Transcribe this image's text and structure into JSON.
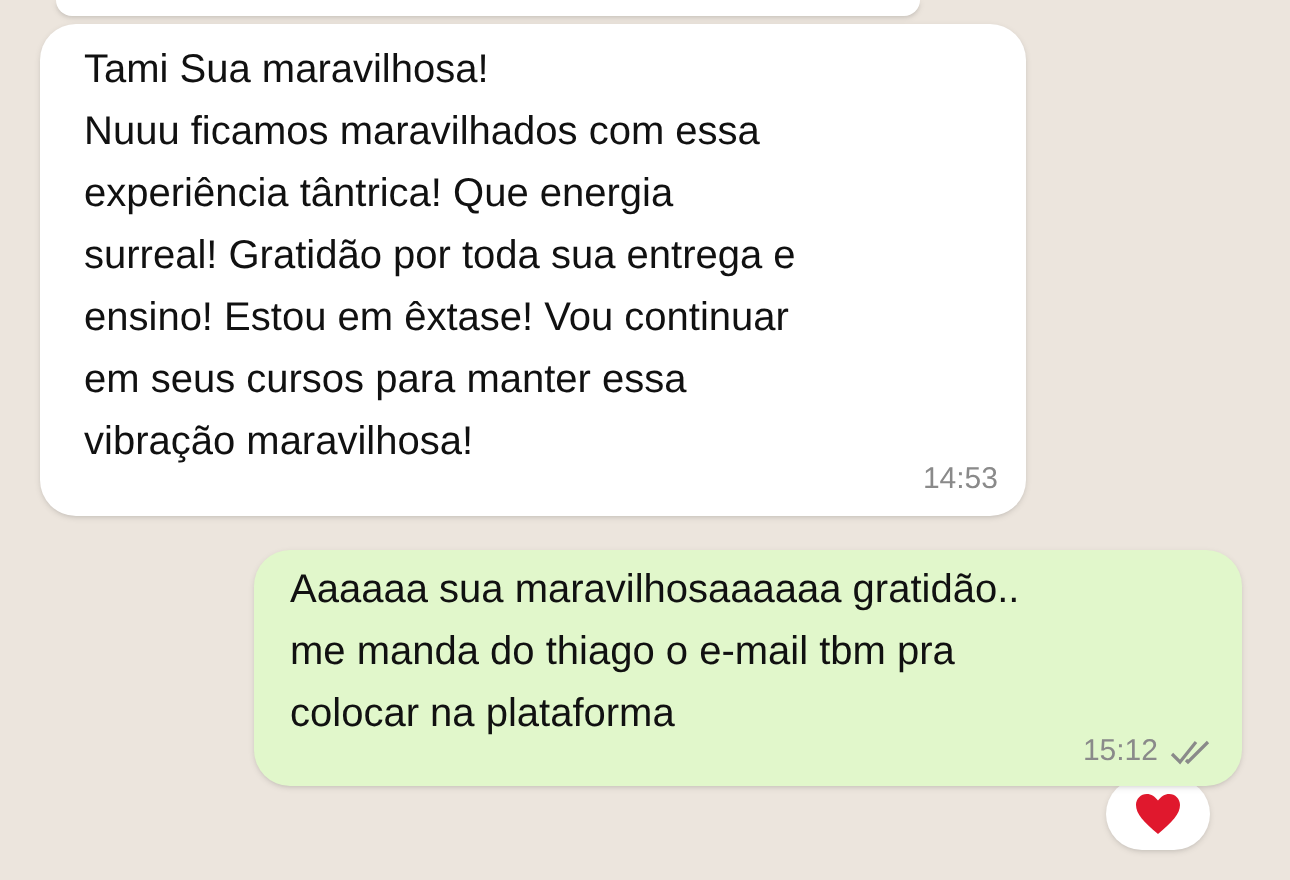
{
  "messages": [
    {
      "kind": "previous",
      "outgoing": false
    },
    {
      "kind": "text",
      "outgoing": false,
      "text": "Tami Sua maravilhosa!\nNuuu ficamos maravilhados com essa\nexperiência tântrica! Que energia\nsurreal! Gratidão por toda sua entrega e\nensino! Estou em êxtase! Vou continuar\nem seus cursos para manter essa\nvibração maravilhosa!",
      "time": "14:53"
    },
    {
      "kind": "text",
      "outgoing": true,
      "text": "Aaaaaa sua maravilhosaaaaaa gratidão..\nme manda do thiago o e-mail tbm pra\ncolocar na plataforma",
      "time": "15:12",
      "read": false,
      "reactions": [
        {
          "kind": "heart"
        }
      ]
    }
  ]
}
